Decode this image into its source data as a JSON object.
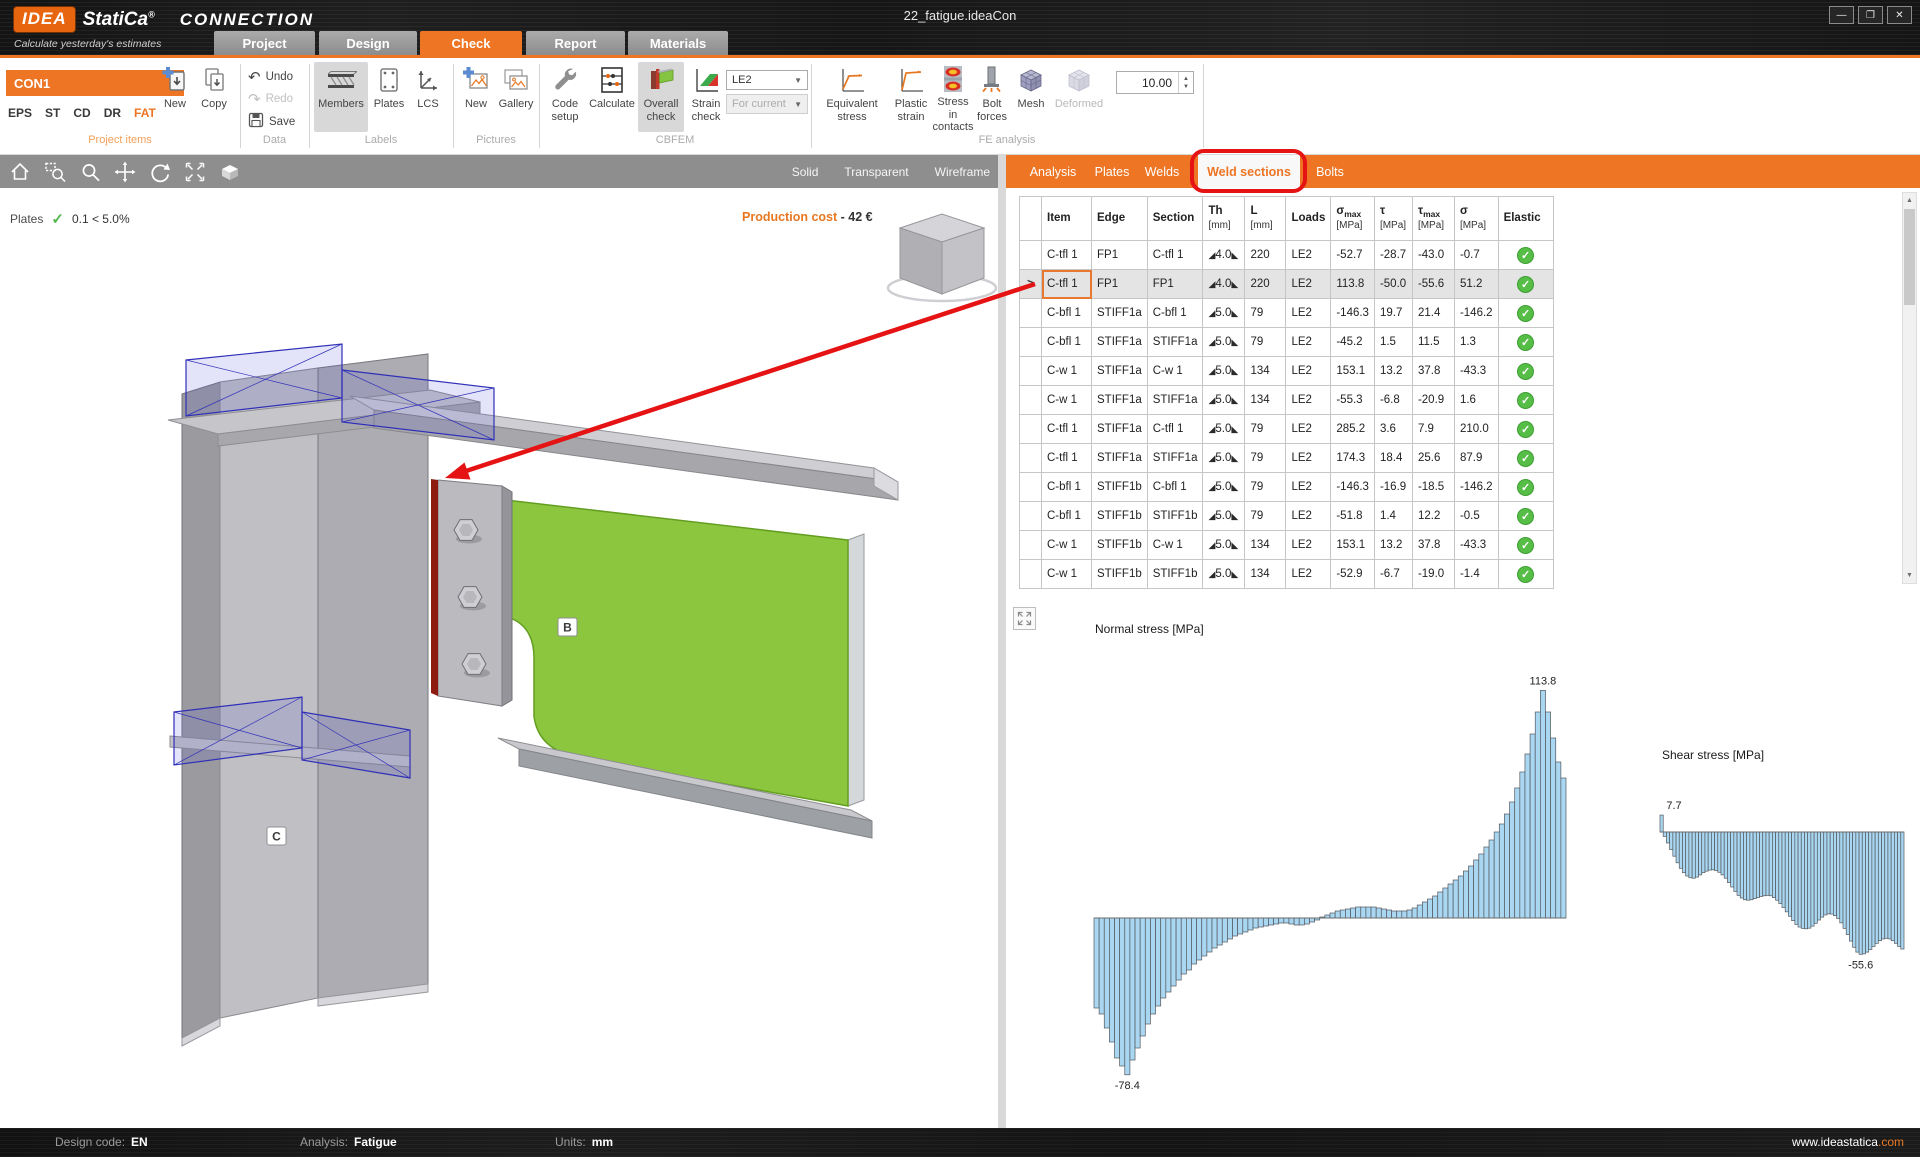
{
  "window": {
    "title": "22_fatigue.ideaCon",
    "minimize": "—",
    "maximize": "❐",
    "close": "✕"
  },
  "brand": {
    "logo": "IDEA",
    "name": "StatiCa",
    "reg": "®",
    "product": "CONNECTION",
    "tagline": "Calculate yesterday's estimates"
  },
  "ribbon_tabs": [
    {
      "label": "Project"
    },
    {
      "label": "Design"
    },
    {
      "label": "Check"
    },
    {
      "label": "Report"
    },
    {
      "label": "Materials"
    }
  ],
  "active_ribbon_tab": "Check",
  "ribbon": {
    "project_items": {
      "group_label": "Project items",
      "selected_item": "CON1",
      "dropdown_arrow": "▼",
      "modes": [
        "EPS",
        "ST",
        "CD",
        "DR",
        "FAT"
      ],
      "active_mode": "FAT",
      "new_label": "New",
      "copy_label": "Copy"
    },
    "data": {
      "group_label": "Data",
      "undo": "Undo",
      "redo": "Redo",
      "save": "Save"
    },
    "labels": {
      "group_label": "Labels",
      "members": "Members",
      "plates": "Plates",
      "lcs": "LCS"
    },
    "pictures": {
      "group_label": "Pictures",
      "new": "New",
      "gallery": "Gallery"
    },
    "cbfem": {
      "group_label": "CBFEM",
      "code_setup": [
        "Code",
        "setup"
      ],
      "calculate": "Calculate",
      "overall_check": [
        "Overall",
        "check"
      ],
      "strain_check": [
        "Strain",
        "check"
      ],
      "load_effect": "LE2",
      "scope": "For current"
    },
    "fe_analysis": {
      "group_label": "FE analysis",
      "equivalent_stress": [
        "Equivalent",
        "stress"
      ],
      "plastic_strain": [
        "Plastic",
        "strain"
      ],
      "stress_in_contacts": [
        "Stress in",
        "contacts"
      ],
      "bolt_forces": [
        "Bolt",
        "forces"
      ],
      "mesh": "Mesh",
      "deformed": "Deformed",
      "scale_value": "10.00"
    }
  },
  "viewport": {
    "view_modes": [
      "Solid",
      "Transparent",
      "Wireframe"
    ],
    "plates_check": {
      "label": "Plates",
      "check": "✓",
      "value": "0.1 < 5.0%"
    },
    "production_cost": {
      "label": "Production cost",
      "value": " -  42 €"
    },
    "member_labels": {
      "beam": "B",
      "column": "C"
    }
  },
  "right_panel": {
    "tabs": [
      "Analysis",
      "Plates",
      "Welds",
      "Weld sections",
      "Bolts"
    ],
    "active_tab": "Weld sections",
    "table": {
      "columns": [
        {
          "label": ""
        },
        {
          "label": "Item"
        },
        {
          "label": "Edge"
        },
        {
          "label": "Section"
        },
        {
          "label": "Th",
          "unit": "[mm]"
        },
        {
          "label": "L",
          "unit": "[mm]"
        },
        {
          "label": "Loads"
        },
        {
          "label": "σ",
          "sub": "max",
          "unit": "[MPa]"
        },
        {
          "label": "τ",
          "unit": "[MPa]"
        },
        {
          "label": "τ",
          "sub": "max",
          "unit": "[MPa]"
        },
        {
          "label": "σ",
          "unit": "[MPa]"
        },
        {
          "label": "Elastic"
        }
      ],
      "weld_glyphs": {
        "left": "◢",
        "right": "◣"
      },
      "selected_marker": ">",
      "status_glyph": "✓",
      "rows": [
        {
          "item": "C-tfl 1",
          "edge": "FP1",
          "section": "C-tfl 1",
          "th": "4.0",
          "l": "220",
          "loads": "LE2",
          "s_max": "-52.7",
          "tau": "-28.7",
          "tau_max": "-43.0",
          "sigma": "-0.7",
          "status": "ok"
        },
        {
          "item": "C-tfl 1",
          "edge": "FP1",
          "section": "FP1",
          "th": "4.0",
          "l": "220",
          "loads": "LE2",
          "s_max": "113.8",
          "tau": "-50.0",
          "tau_max": "-55.6",
          "sigma": "51.2",
          "status": "ok",
          "selected": true
        },
        {
          "item": "C-bfl 1",
          "edge": "STIFF1a",
          "section": "C-bfl 1",
          "th": "5.0",
          "l": "79",
          "loads": "LE2",
          "s_max": "-146.3",
          "tau": "19.7",
          "tau_max": "21.4",
          "sigma": "-146.2",
          "status": "ok"
        },
        {
          "item": "C-bfl 1",
          "edge": "STIFF1a",
          "section": "STIFF1a",
          "th": "5.0",
          "l": "79",
          "loads": "LE2",
          "s_max": "-45.2",
          "tau": "1.5",
          "tau_max": "11.5",
          "sigma": "1.3",
          "status": "ok"
        },
        {
          "item": "C-w 1",
          "edge": "STIFF1a",
          "section": "C-w 1",
          "th": "5.0",
          "l": "134",
          "loads": "LE2",
          "s_max": "153.1",
          "tau": "13.2",
          "tau_max": "37.8",
          "sigma": "-43.3",
          "status": "ok"
        },
        {
          "item": "C-w 1",
          "edge": "STIFF1a",
          "section": "STIFF1a",
          "th": "5.0",
          "l": "134",
          "loads": "LE2",
          "s_max": "-55.3",
          "tau": "-6.8",
          "tau_max": "-20.9",
          "sigma": "1.6",
          "status": "ok"
        },
        {
          "item": "C-tfl 1",
          "edge": "STIFF1a",
          "section": "C-tfl 1",
          "th": "5.0",
          "l": "79",
          "loads": "LE2",
          "s_max": "285.2",
          "tau": "3.6",
          "tau_max": "7.9",
          "sigma": "210.0",
          "status": "ok"
        },
        {
          "item": "C-tfl 1",
          "edge": "STIFF1a",
          "section": "STIFF1a",
          "th": "5.0",
          "l": "79",
          "loads": "LE2",
          "s_max": "174.3",
          "tau": "18.4",
          "tau_max": "25.6",
          "sigma": "87.9",
          "status": "ok"
        },
        {
          "item": "C-bfl 1",
          "edge": "STIFF1b",
          "section": "C-bfl 1",
          "th": "5.0",
          "l": "79",
          "loads": "LE2",
          "s_max": "-146.3",
          "tau": "-16.9",
          "tau_max": "-18.5",
          "sigma": "-146.2",
          "status": "ok"
        },
        {
          "item": "C-bfl 1",
          "edge": "STIFF1b",
          "section": "STIFF1b",
          "th": "5.0",
          "l": "79",
          "loads": "LE2",
          "s_max": "-51.8",
          "tau": "1.4",
          "tau_max": "12.2",
          "sigma": "-0.5",
          "status": "ok"
        },
        {
          "item": "C-w 1",
          "edge": "STIFF1b",
          "section": "C-w 1",
          "th": "5.0",
          "l": "134",
          "loads": "LE2",
          "s_max": "153.1",
          "tau": "13.2",
          "tau_max": "37.8",
          "sigma": "-43.3",
          "status": "ok"
        },
        {
          "item": "C-w 1",
          "edge": "STIFF1b",
          "section": "STIFF1b",
          "th": "5.0",
          "l": "134",
          "loads": "LE2",
          "s_max": "-52.9",
          "tau": "-6.7",
          "tau_max": "-19.0",
          "sigma": "-1.4",
          "status": "ok"
        }
      ]
    }
  },
  "chart_data": [
    {
      "type": "bar",
      "title": "Normal stress [MPa]",
      "ylabel": "MPa",
      "max_label": "113.8",
      "min_label": "-78.4",
      "legend": "none",
      "grid": false,
      "values": [
        -45,
        -48,
        -55,
        -62,
        -70,
        -74,
        -78.4,
        -71,
        -65,
        -59,
        -53,
        -48,
        -44,
        -40,
        -37,
        -34,
        -31,
        -28,
        -26,
        -23,
        -21,
        -19,
        -17,
        -15,
        -13.5,
        -12,
        -10.5,
        -9,
        -8,
        -7,
        -6,
        -5,
        -4.5,
        -4,
        -3.5,
        -3,
        -2.5,
        -2.5,
        -3,
        -3.5,
        -3.5,
        -3,
        -2,
        -1,
        0.5,
        1.5,
        2.5,
        3.5,
        4,
        4.5,
        5,
        5.5,
        5.5,
        5.5,
        5.5,
        5,
        4.5,
        4,
        3.5,
        3.5,
        3.5,
        4,
        5,
        6.5,
        8,
        9.5,
        11,
        13,
        15,
        17,
        19,
        21,
        23.5,
        26,
        29,
        32,
        35.5,
        39,
        43,
        47,
        52,
        58,
        65,
        73,
        82,
        92,
        103,
        113.8,
        103,
        90,
        78,
        70
      ]
    },
    {
      "type": "bar",
      "title": "Shear stress [MPa]",
      "ylabel": "MPa",
      "max_label": "7.7",
      "min_label": "-55.6",
      "legend": "none",
      "grid": false,
      "values": [
        7.7,
        -2,
        -5,
        -8,
        -11,
        -14,
        -16.5,
        -18.5,
        -20,
        -20.8,
        -21,
        -20.5,
        -19.5,
        -18.5,
        -17.8,
        -17.3,
        -17.2,
        -17.5,
        -18.3,
        -19.5,
        -21,
        -23,
        -25,
        -27,
        -28.8,
        -30,
        -30.8,
        -31,
        -30.8,
        -30.3,
        -29.8,
        -29.3,
        -29,
        -28.8,
        -29,
        -29.8,
        -31,
        -32.5,
        -34.3,
        -36.3,
        -38.3,
        -40.3,
        -42,
        -43.2,
        -43.8,
        -44,
        -43.7,
        -42.8,
        -41.5,
        -40,
        -38.7,
        -37.7,
        -37.2,
        -37.3,
        -38,
        -39.3,
        -41.3,
        -43.8,
        -46.6,
        -49.6,
        -52.4,
        -54.6,
        -55.6,
        -55.4,
        -54.6,
        -53.4,
        -52,
        -50.6,
        -49.4,
        -48.6,
        -48.3,
        -48.6,
        -49.4,
        -50.6,
        -52,
        -53.2
      ]
    }
  ],
  "statusbar": {
    "design_code_label": "Design code:",
    "design_code": "EN",
    "analysis_label": "Analysis:",
    "analysis": "Fatigue",
    "units_label": "Units:",
    "units": "mm",
    "website_prefix": "www.ideastatica",
    "website_suffix": ".com"
  },
  "colors": {
    "accent": "#ED7524",
    "status_ok": "#56BE46",
    "chart_fill": "#A9D7F2",
    "annotation_red": "#E51313",
    "plate_green": "#8CC63E"
  }
}
